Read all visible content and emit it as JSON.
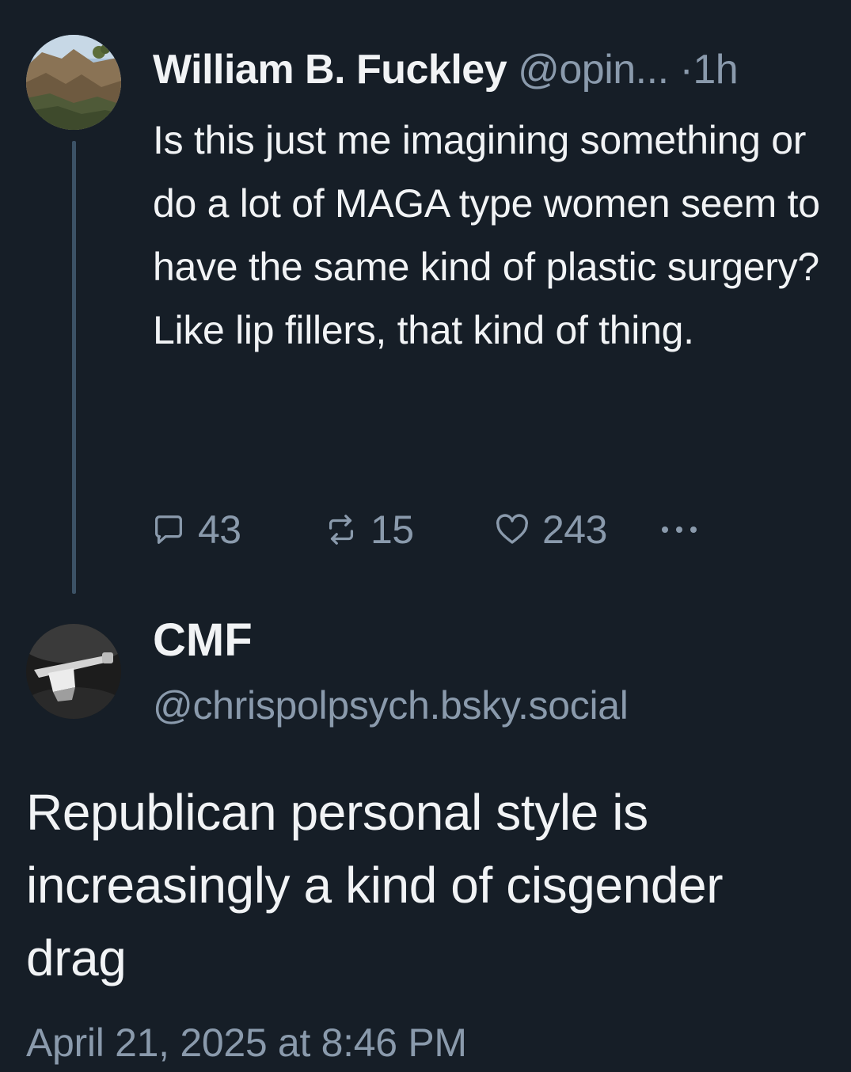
{
  "parent_post": {
    "display_name": "William B. Fuckley",
    "handle": "@opin...",
    "separator": "·",
    "age": "1h",
    "text": "Is this just me imagining something or do a lot of MAGA type women seem to have the same kind of plastic surgery? Like lip fillers, that kind of thing.",
    "reply_count": "43",
    "repost_count": "15",
    "like_count": "243",
    "icons": [
      "comment-icon",
      "repost-icon",
      "heart-icon",
      "more-icon"
    ]
  },
  "reply_post": {
    "display_name": "CMF",
    "handle": "@chrispolpsych.bsky.social",
    "text": "Republican personal style is increasingly a kind of cisgender drag",
    "timestamp": "April 21, 2025 at 8:46 PM"
  },
  "colors": {
    "background": "#161e27",
    "text": "#f1f3f5",
    "muted": "#8a9aac",
    "thread_line": "#3c5266"
  }
}
